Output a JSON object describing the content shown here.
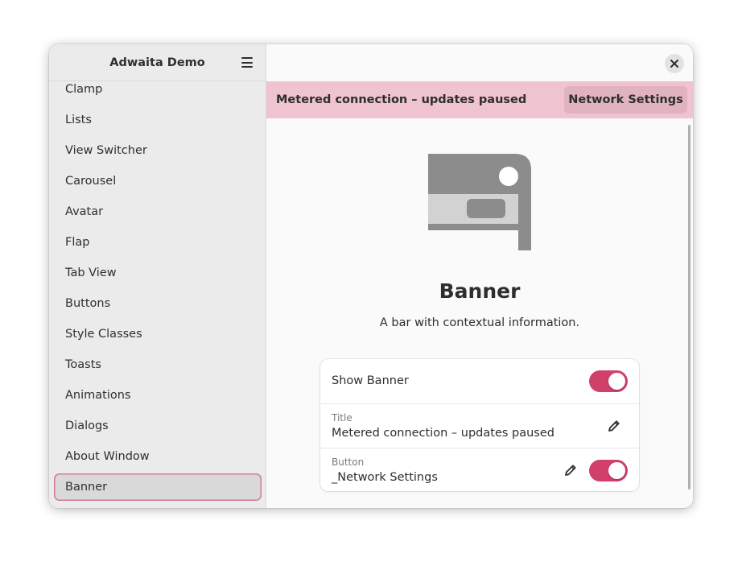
{
  "sidebar": {
    "title": "Adwaita Demo",
    "menu_icon": "hamburger-menu-icon",
    "items": [
      {
        "label": "Clamp"
      },
      {
        "label": "Lists"
      },
      {
        "label": "View Switcher"
      },
      {
        "label": "Carousel"
      },
      {
        "label": "Avatar"
      },
      {
        "label": "Flap"
      },
      {
        "label": "Tab View"
      },
      {
        "label": "Buttons"
      },
      {
        "label": "Style Classes"
      },
      {
        "label": "Toasts"
      },
      {
        "label": "Animations"
      },
      {
        "label": "Dialogs"
      },
      {
        "label": "About Window"
      },
      {
        "label": "Banner",
        "selected": true
      }
    ]
  },
  "header": {
    "close_icon": "close-icon"
  },
  "banner": {
    "title": "Metered connection – updates paused",
    "button_label": "Network Settings",
    "color": "#efc3cf"
  },
  "page": {
    "title": "Banner",
    "description": "A bar with contextual information.",
    "illustration_icon": "banner-illustration-icon"
  },
  "settings": {
    "show_banner": {
      "label": "Show Banner",
      "enabled": true
    },
    "title_row": {
      "sublabel": "Title",
      "value": "Metered connection – updates paused",
      "icon": "edit-pencil-icon"
    },
    "button_row": {
      "sublabel": "Button",
      "value": "_Network Settings",
      "icon": "edit-pencil-icon",
      "enabled": true
    }
  },
  "colors": {
    "accent": "#d0406a",
    "sidebar_bg": "#ebebeb",
    "content_bg": "#fafafa"
  }
}
